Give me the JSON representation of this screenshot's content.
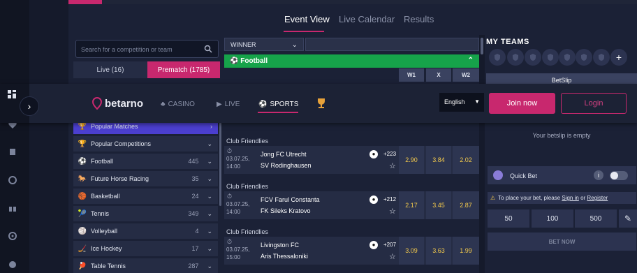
{
  "tabs": [
    "Event View",
    "Live Calendar",
    "Results"
  ],
  "search": {
    "placeholder": "Search for a competition or team"
  },
  "segment": {
    "live": "Live (16)",
    "prematch": "Prematch (1785)"
  },
  "market": {
    "selected": "WINNER"
  },
  "sport_bar": "Football",
  "columns": [
    "W1",
    "X",
    "W2"
  ],
  "my_teams": {
    "title": "MY TEAMS",
    "add": "+"
  },
  "betslip": {
    "tab": "BetSlip",
    "empty": "Your betslip is empty"
  },
  "header": {
    "logo": "betarno",
    "nav": [
      "CASINO",
      "LIVE",
      "SPORTS"
    ],
    "language": "English",
    "join": "Join now",
    "login": "Login"
  },
  "sports": [
    {
      "label": "Popular Matches",
      "count": "",
      "icon": "🏆"
    },
    {
      "label": "Popular Competitions",
      "count": "",
      "icon": "🏆"
    },
    {
      "label": "Football",
      "count": "445",
      "icon": "⚽"
    },
    {
      "label": "Future Horse Racing",
      "count": "35",
      "icon": "🐎"
    },
    {
      "label": "Basketball",
      "count": "24",
      "icon": "🏀"
    },
    {
      "label": "Tennis",
      "count": "349",
      "icon": "🎾"
    },
    {
      "label": "Volleyball",
      "count": "4",
      "icon": "🏐"
    },
    {
      "label": "Ice Hockey",
      "count": "17",
      "icon": "🏒"
    },
    {
      "label": "Table Tennis",
      "count": "287",
      "icon": "🏓"
    }
  ],
  "events": [
    {
      "section": "Club Friendlies",
      "date": "03.07.25,",
      "time": "14:00",
      "team1": "Jong FC Utrecht",
      "team2": "SV Rodinghausen",
      "more": "+223",
      "odds": [
        "2.90",
        "3.84",
        "2.02"
      ]
    },
    {
      "section": "Club Friendlies",
      "date": "03.07.25,",
      "time": "14:00",
      "team1": "FCV Farul Constanta",
      "team2": "FK Sileks Kratovo",
      "more": "+212",
      "odds": [
        "2.17",
        "3.45",
        "2.87"
      ]
    },
    {
      "section": "Club Friendlies",
      "date": "03.07.25,",
      "time": "15:00",
      "team1": "Livingston FC",
      "team2": "Aris Thessaloniki",
      "more": "+207",
      "odds": [
        "3.09",
        "3.63",
        "1.99"
      ]
    }
  ],
  "quick_bet": {
    "label": "Quick Bet",
    "info": "i"
  },
  "warning": {
    "text": "To place your bet, please",
    "sign_in": "Sign in",
    "or": "or",
    "register": "Register"
  },
  "amounts": [
    "50",
    "100",
    "500"
  ],
  "bet_now": "BET NOW"
}
